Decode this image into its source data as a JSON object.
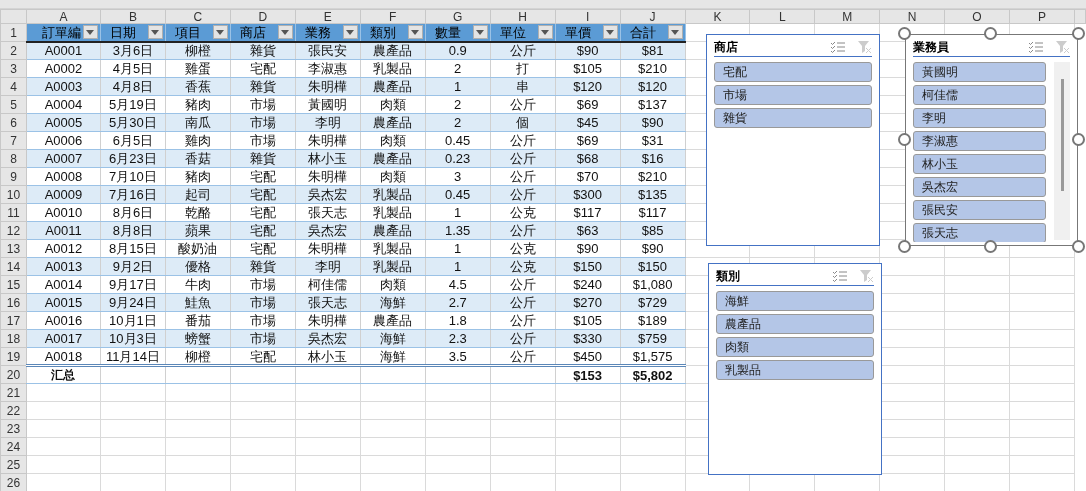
{
  "column_letters": [
    "A",
    "B",
    "C",
    "D",
    "E",
    "F",
    "G",
    "H",
    "I",
    "J",
    "K",
    "L",
    "M",
    "N",
    "O",
    "P"
  ],
  "headers": [
    "訂單編",
    "日期",
    "項目",
    "商店",
    "業務",
    "類別",
    "數量",
    "單位",
    "單價",
    "合計"
  ],
  "rows": [
    [
      "A0001",
      "3月6日",
      "柳橙",
      "雜貨",
      "張民安",
      "農產品",
      "0.9",
      "公斤",
      "$90",
      "$81"
    ],
    [
      "A0002",
      "4月5日",
      "雞蛋",
      "宅配",
      "李淑惠",
      "乳製品",
      "2",
      "打",
      "$105",
      "$210"
    ],
    [
      "A0003",
      "4月8日",
      "香蕉",
      "雜貨",
      "朱明樺",
      "農產品",
      "1",
      "串",
      "$120",
      "$120"
    ],
    [
      "A0004",
      "5月19日",
      "豬肉",
      "市場",
      "黃國明",
      "肉類",
      "2",
      "公斤",
      "$69",
      "$137"
    ],
    [
      "A0005",
      "5月30日",
      "南瓜",
      "市場",
      "李明",
      "農產品",
      "2",
      "個",
      "$45",
      "$90"
    ],
    [
      "A0006",
      "6月5日",
      "雞肉",
      "市場",
      "朱明樺",
      "肉類",
      "0.45",
      "公斤",
      "$69",
      "$31"
    ],
    [
      "A0007",
      "6月23日",
      "香菇",
      "雜貨",
      "林小玉",
      "農產品",
      "0.23",
      "公斤",
      "$68",
      "$16"
    ],
    [
      "A0008",
      "7月10日",
      "豬肉",
      "宅配",
      "朱明樺",
      "肉類",
      "3",
      "公斤",
      "$70",
      "$210"
    ],
    [
      "A0009",
      "7月16日",
      "起司",
      "宅配",
      "吳杰宏",
      "乳製品",
      "0.45",
      "公斤",
      "$300",
      "$135"
    ],
    [
      "A0010",
      "8月6日",
      "乾酪",
      "宅配",
      "張天志",
      "乳製品",
      "1",
      "公克",
      "$117",
      "$117"
    ],
    [
      "A0011",
      "8月8日",
      "蘋果",
      "宅配",
      "吳杰宏",
      "農產品",
      "1.35",
      "公斤",
      "$63",
      "$85"
    ],
    [
      "A0012",
      "8月15日",
      "酸奶油",
      "宅配",
      "朱明樺",
      "乳製品",
      "1",
      "公克",
      "$90",
      "$90"
    ],
    [
      "A0013",
      "9月2日",
      "優格",
      "雜貨",
      "李明",
      "乳製品",
      "1",
      "公克",
      "$150",
      "$150"
    ],
    [
      "A0014",
      "9月17日",
      "牛肉",
      "市場",
      "柯佳儒",
      "肉類",
      "4.5",
      "公斤",
      "$240",
      "$1,080"
    ],
    [
      "A0015",
      "9月24日",
      "鮭魚",
      "市場",
      "張天志",
      "海鮮",
      "2.7",
      "公斤",
      "$270",
      "$729"
    ],
    [
      "A0016",
      "10月1日",
      "番茄",
      "市場",
      "朱明樺",
      "農產品",
      "1.8",
      "公斤",
      "$105",
      "$189"
    ],
    [
      "A0017",
      "10月3日",
      "螃蟹",
      "市場",
      "吳杰宏",
      "海鮮",
      "2.3",
      "公斤",
      "$330",
      "$759"
    ],
    [
      "A0018",
      "11月14日",
      "柳橙",
      "宅配",
      "林小玉",
      "海鮮",
      "3.5",
      "公斤",
      "$450",
      "$1,575"
    ]
  ],
  "total_row": {
    "label": "汇总",
    "unit_price": "$153",
    "sum": "$5,802"
  },
  "row_numbers": [
    "1",
    "2",
    "3",
    "4",
    "5",
    "6",
    "7",
    "8",
    "9",
    "10",
    "11",
    "12",
    "13",
    "14",
    "15",
    "16",
    "17",
    "18",
    "19",
    "20",
    "21",
    "22",
    "23",
    "24",
    "25",
    "26"
  ],
  "slicers": [
    {
      "title": "商店",
      "selected": false,
      "scrollbar": false,
      "items": [
        {
          "label": "宅配",
          "selected": true
        },
        {
          "label": "市場",
          "selected": true
        },
        {
          "label": "雜貨",
          "selected": true
        }
      ]
    },
    {
      "title": "業務員",
      "selected": true,
      "scrollbar": true,
      "items": [
        {
          "label": "黃國明",
          "selected": true
        },
        {
          "label": "柯佳儒",
          "selected": true
        },
        {
          "label": "李明",
          "selected": true
        },
        {
          "label": "李淑惠",
          "selected": true
        },
        {
          "label": "林小玉",
          "selected": true
        },
        {
          "label": "吳杰宏",
          "selected": true
        },
        {
          "label": "張民安",
          "selected": true
        },
        {
          "label": "張天志",
          "selected": true
        }
      ]
    },
    {
      "title": "類別",
      "selected": false,
      "scrollbar": false,
      "items": [
        {
          "label": "海鮮",
          "selected": true
        },
        {
          "label": "農產品",
          "selected": true
        },
        {
          "label": "肉類",
          "selected": true
        },
        {
          "label": "乳製品",
          "selected": true
        }
      ]
    }
  ]
}
